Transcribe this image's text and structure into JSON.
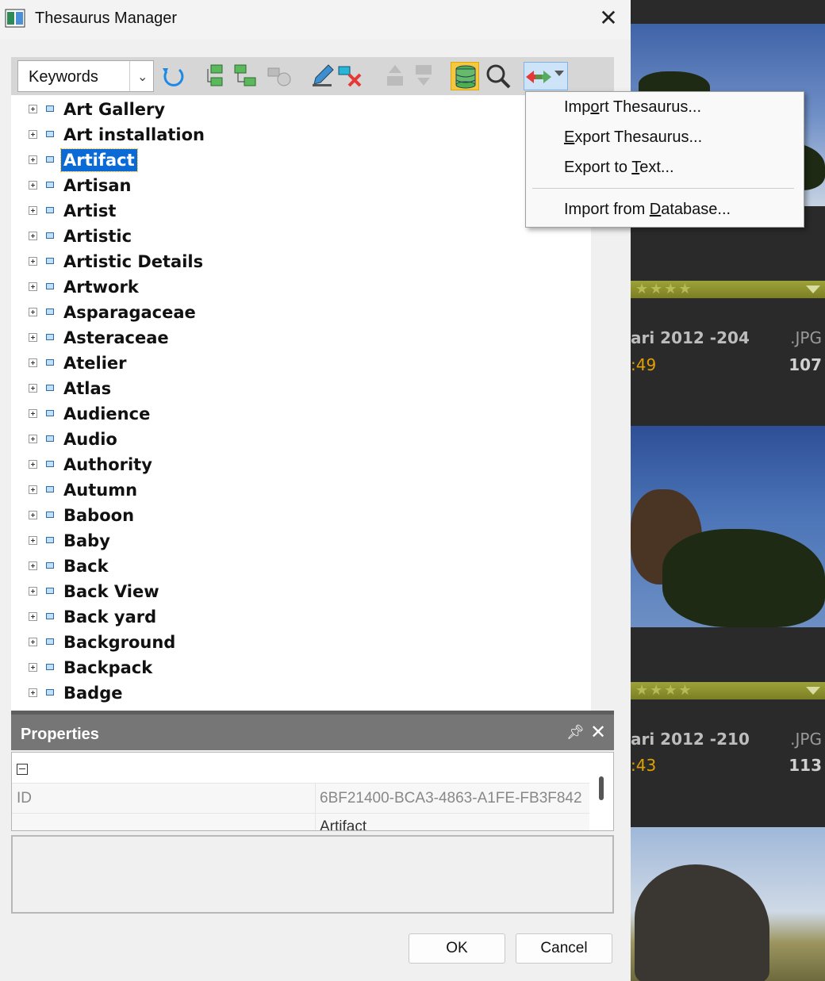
{
  "window": {
    "title": "Thesaurus Manager"
  },
  "toolbar": {
    "combo_value": "Keywords"
  },
  "tree_items": [
    "Art Gallery",
    "Art installation",
    "Artifact",
    "Artisan",
    "Artist",
    "Artistic",
    "Artistic Details",
    "Artwork",
    "Asparagaceae",
    "Asteraceae",
    "Atelier",
    "Atlas",
    "Audience",
    "Audio",
    "Authority",
    "Autumn",
    "Baboon",
    "Baby",
    "Back",
    "Back View",
    "Back yard",
    "Background",
    "Backpack",
    "Badge"
  ],
  "selected": "Artifact",
  "menu": {
    "items": [
      {
        "pre": "Imp",
        "mn": "o",
        "post": "rt Thesaurus..."
      },
      {
        "pre": "",
        "mn": "E",
        "post": "xport Thesaurus..."
      },
      {
        "pre": "Export to ",
        "mn": "T",
        "post": "ext..."
      },
      {
        "pre": "Import from ",
        "mn": "D",
        "post": "atabase..."
      }
    ]
  },
  "properties": {
    "title": "Properties",
    "rows": [
      {
        "key": "ID",
        "value": "6BF21400-BCA3-4863-A1FE-FB3F842"
      },
      {
        "key": "",
        "value": "Artifact"
      }
    ]
  },
  "buttons": {
    "ok": "OK",
    "cancel": "Cancel"
  },
  "background": {
    "file1": {
      "name": "ari 2012 -204",
      "time": ":49",
      "ext": ".JPG",
      "num": "107"
    },
    "file2": {
      "name": "ari 2012 -210",
      "time": ":43",
      "ext": ".JPG",
      "num": "113"
    }
  }
}
